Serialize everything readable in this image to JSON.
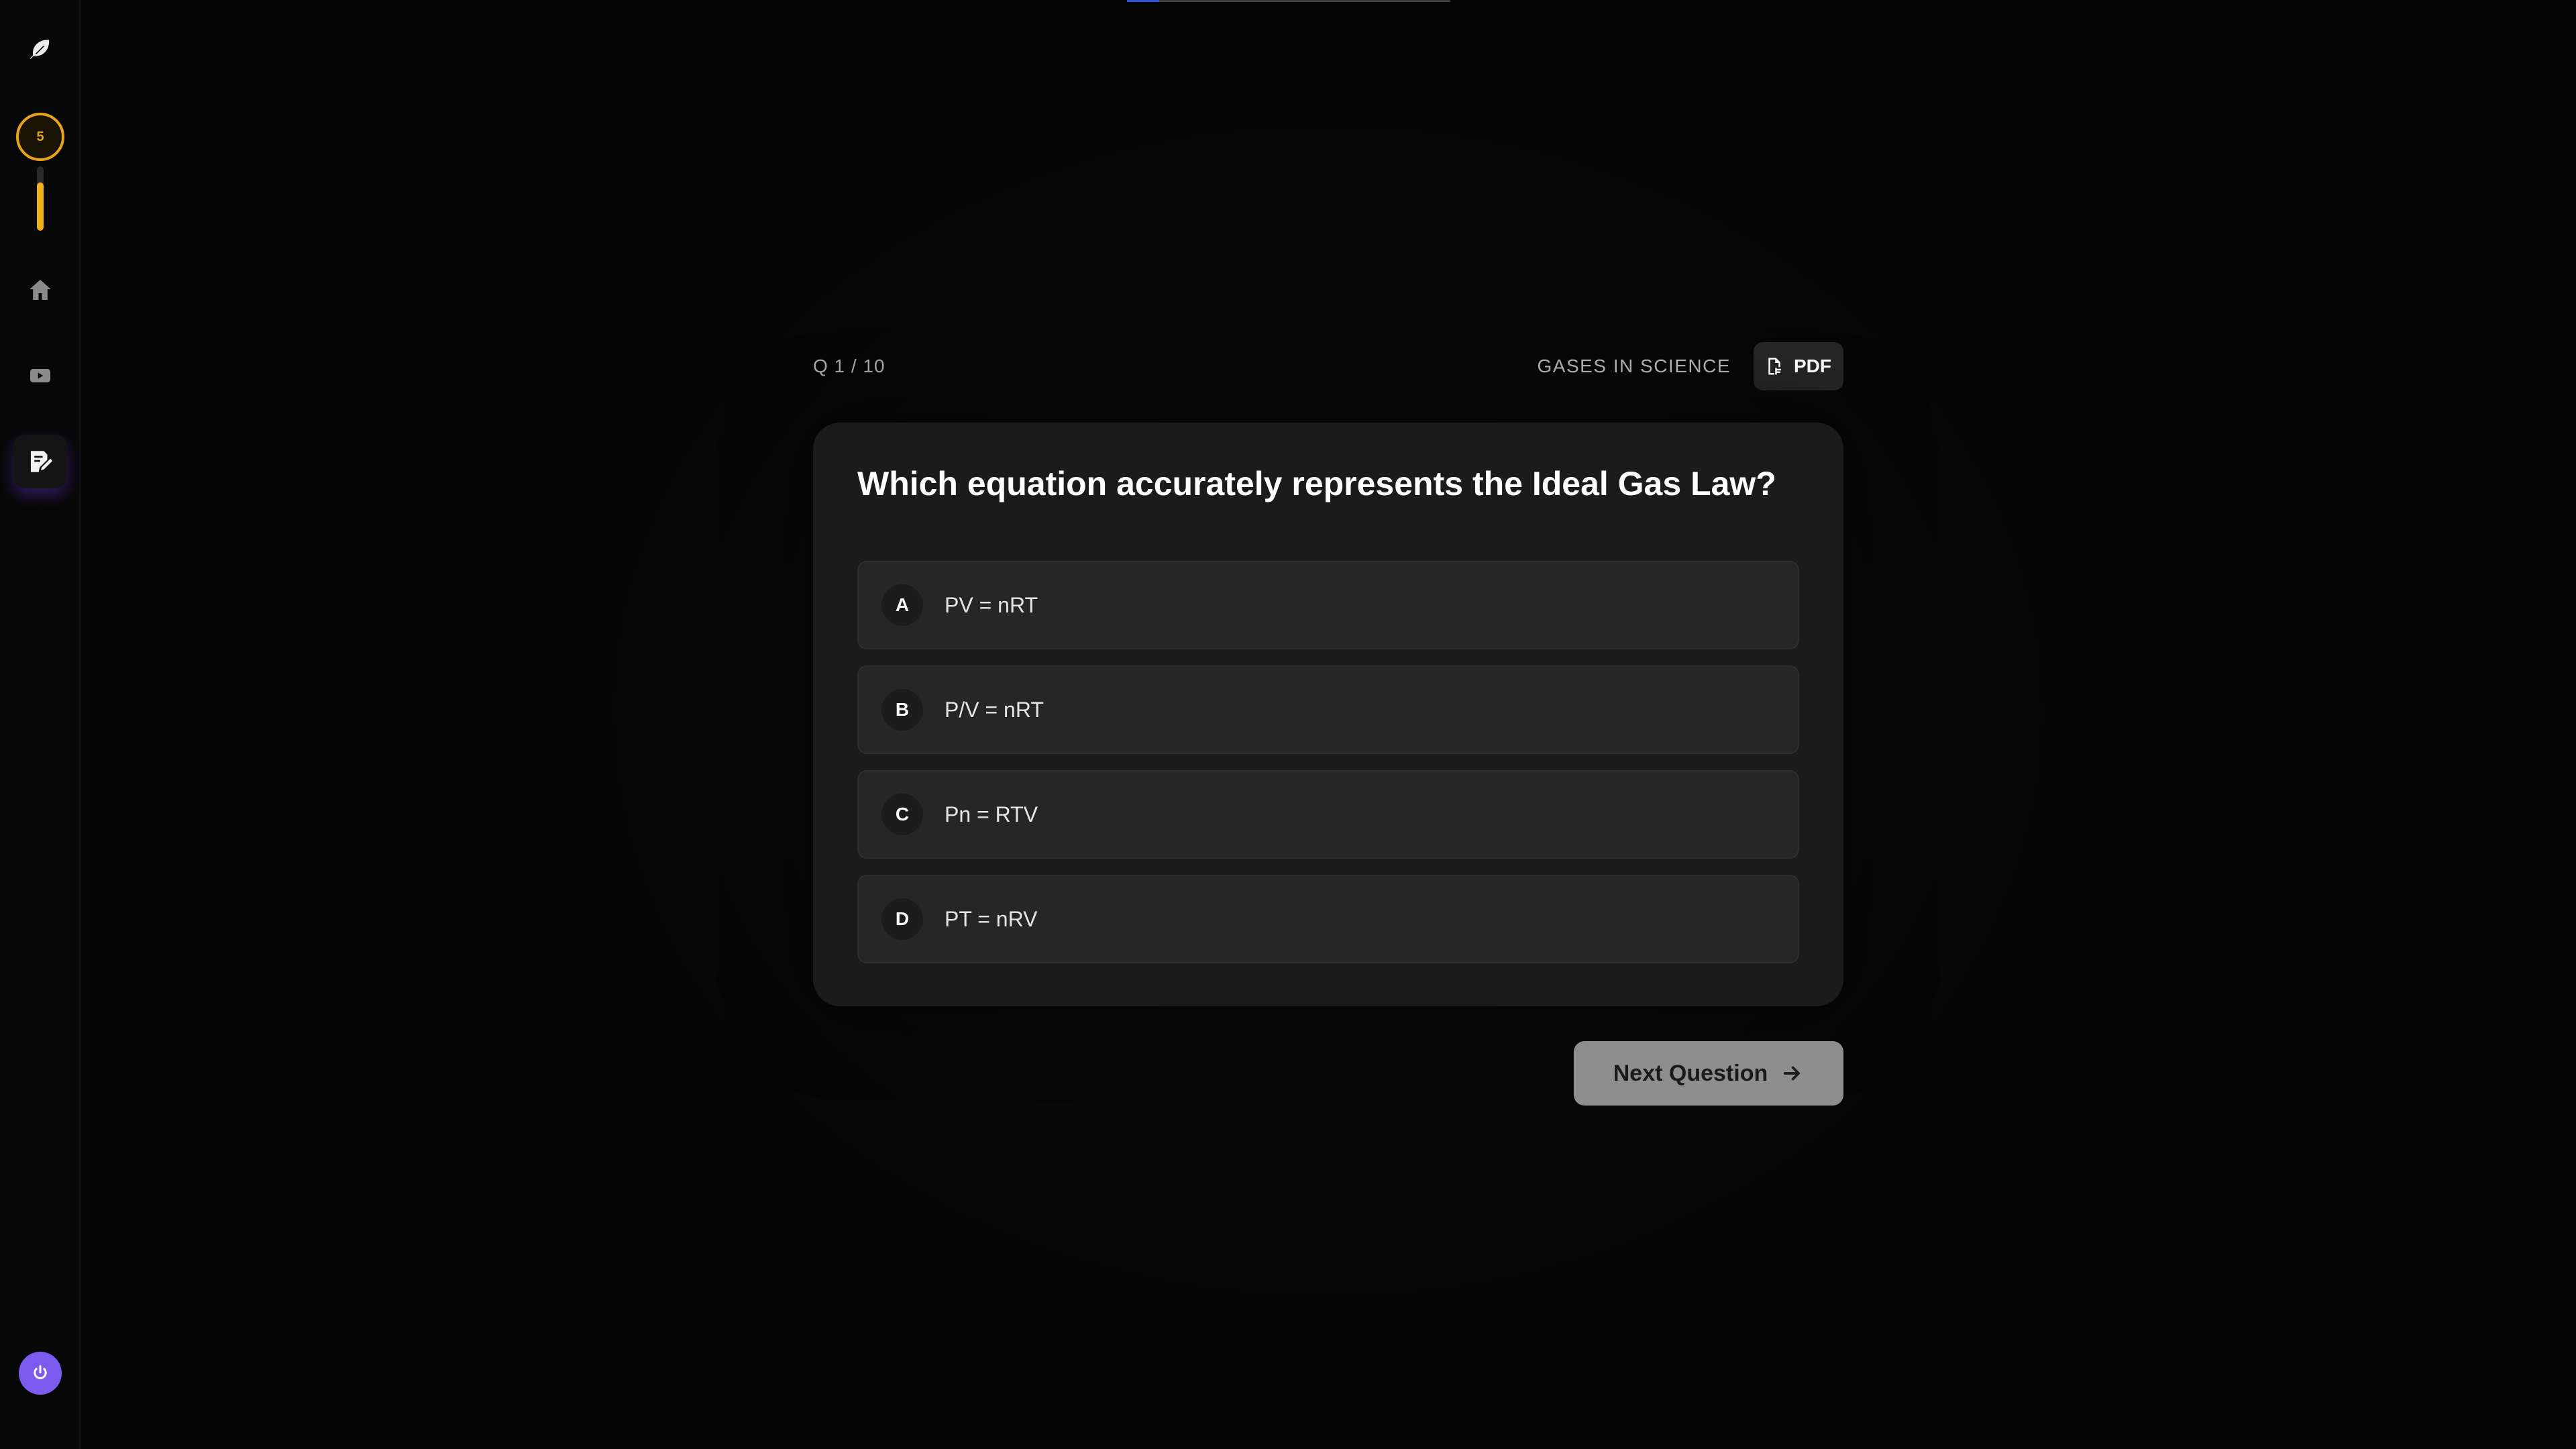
{
  "progress": {
    "fraction": 0.1
  },
  "sidebar": {
    "logo_icon": "feather-icon",
    "streak": {
      "count": "5",
      "level_fraction": 0.75
    },
    "items": [
      {
        "name": "home",
        "icon": "home-icon"
      },
      {
        "name": "videos",
        "icon": "video-icon"
      },
      {
        "name": "quizzes",
        "icon": "quiz-edit-icon",
        "active": true
      }
    ],
    "power_icon": "power-icon"
  },
  "quiz": {
    "counter": "Q 1 / 10",
    "topic": "GASES IN SCIENCE",
    "pdf_label": "PDF",
    "question": "Which equation accurately represents the Ideal Gas Law?",
    "options": [
      {
        "letter": "A",
        "text": "PV = nRT"
      },
      {
        "letter": "B",
        "text": "P/V = nRT"
      },
      {
        "letter": "C",
        "text": "Pn = RTV"
      },
      {
        "letter": "D",
        "text": "PT = nRV"
      }
    ],
    "next_label": "Next Question"
  },
  "colors": {
    "accent_streak": "#e8a21c",
    "accent_power": "#7c5cf0",
    "progress": "#2b4fd8"
  }
}
